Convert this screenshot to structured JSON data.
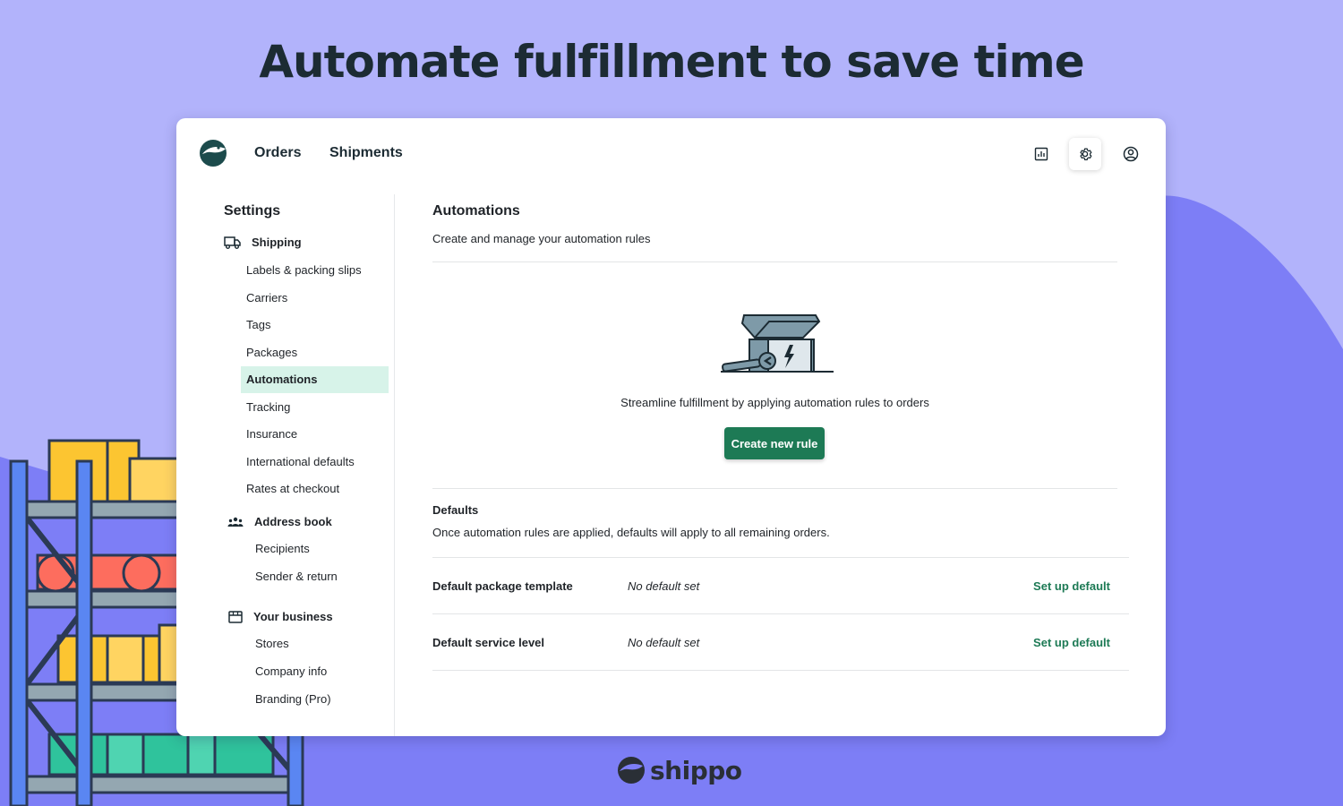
{
  "headline": "Automate fulfillment to save time",
  "colors": {
    "background": "#b2b3fb",
    "blob": "#7d7ef6",
    "accent_green": "#1d7a55",
    "active_bg": "#d7f3e9",
    "dark": "#1c2b33"
  },
  "nav": {
    "orders": "Orders",
    "shipments": "Shipments"
  },
  "top_icons": [
    "reports-icon",
    "gear-icon",
    "user-circle-icon"
  ],
  "sidebar": {
    "title": "Settings",
    "shipping": {
      "label": "Shipping",
      "icon": "truck-icon",
      "items": [
        "Labels & packing slips",
        "Carriers",
        "Tags",
        "Packages",
        "Automations",
        "Tracking",
        "Insurance",
        "International defaults",
        "Rates at checkout"
      ]
    },
    "address_book": {
      "label": "Address book",
      "icon": "people-icon",
      "items": [
        "Recipients",
        "Sender & return"
      ]
    },
    "your_business": {
      "label": "Your business",
      "icon": "store-icon",
      "items": [
        "Stores",
        "Company info",
        "Branding (Pro)"
      ]
    },
    "active_item": "Automations"
  },
  "main": {
    "title": "Automations",
    "description": "Create and manage your automation rules",
    "empty_state_text": "Streamline fulfillment by applying automation rules to orders",
    "create_button": "Create new rule",
    "defaults": {
      "title": "Defaults",
      "description": "Once automation rules are applied, defaults will apply to all remaining orders.",
      "rows": [
        {
          "label": "Default package template",
          "value": "No default set",
          "action": "Set up default"
        },
        {
          "label": "Default service level",
          "value": "No default set",
          "action": "Set up default"
        }
      ]
    }
  },
  "brand": {
    "name": "shippo"
  }
}
